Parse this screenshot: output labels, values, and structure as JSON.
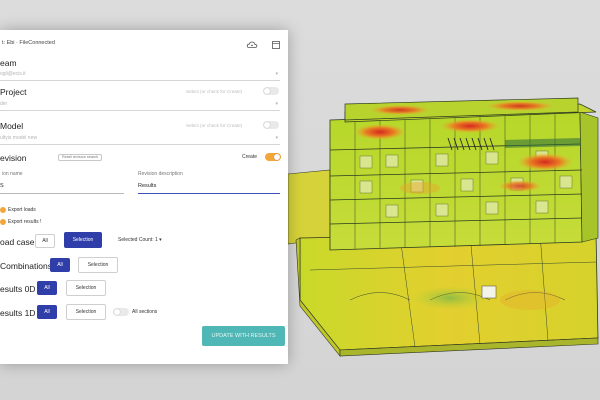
{
  "header": {
    "title": "t: Ebi · FileConnected",
    "icons": [
      "cloud-sync-icon",
      "window-icon"
    ]
  },
  "team": {
    "title": "eam",
    "value": "ogli@ecis.it"
  },
  "project": {
    "title": "Project",
    "hint": "Select (or check for Create)",
    "value": "der"
  },
  "model": {
    "title": "Model",
    "hint": "Select (or check for Create)",
    "value": "ultyis model new"
  },
  "revision": {
    "title": "evision",
    "tag": "Retail revision search",
    "create_label": "Create",
    "name_label": "ion name",
    "name_value": "S",
    "description_label": "Revision description",
    "description_value": "Results"
  },
  "export": {
    "loads": "Export loads",
    "results": "Export results !"
  },
  "load_case": {
    "title": "oad case",
    "all": "All",
    "selection": "Selection",
    "selected_count": "Selected Count: 1"
  },
  "combinations": {
    "title": "Combinations",
    "all": "All",
    "selection": "Selection"
  },
  "results_0d": {
    "title": "esults 0D",
    "all": "All",
    "selection": "Selection"
  },
  "results_1d": {
    "title": "esults 1D",
    "all": "All",
    "selection": "Selection",
    "all_sections": "All sections"
  },
  "update_button": "UPDATE WITH RESULTS",
  "colors": {
    "accent_orange": "#f3a73b",
    "primary_blue": "#2f3ea8",
    "update_teal": "#4fb7b5"
  }
}
